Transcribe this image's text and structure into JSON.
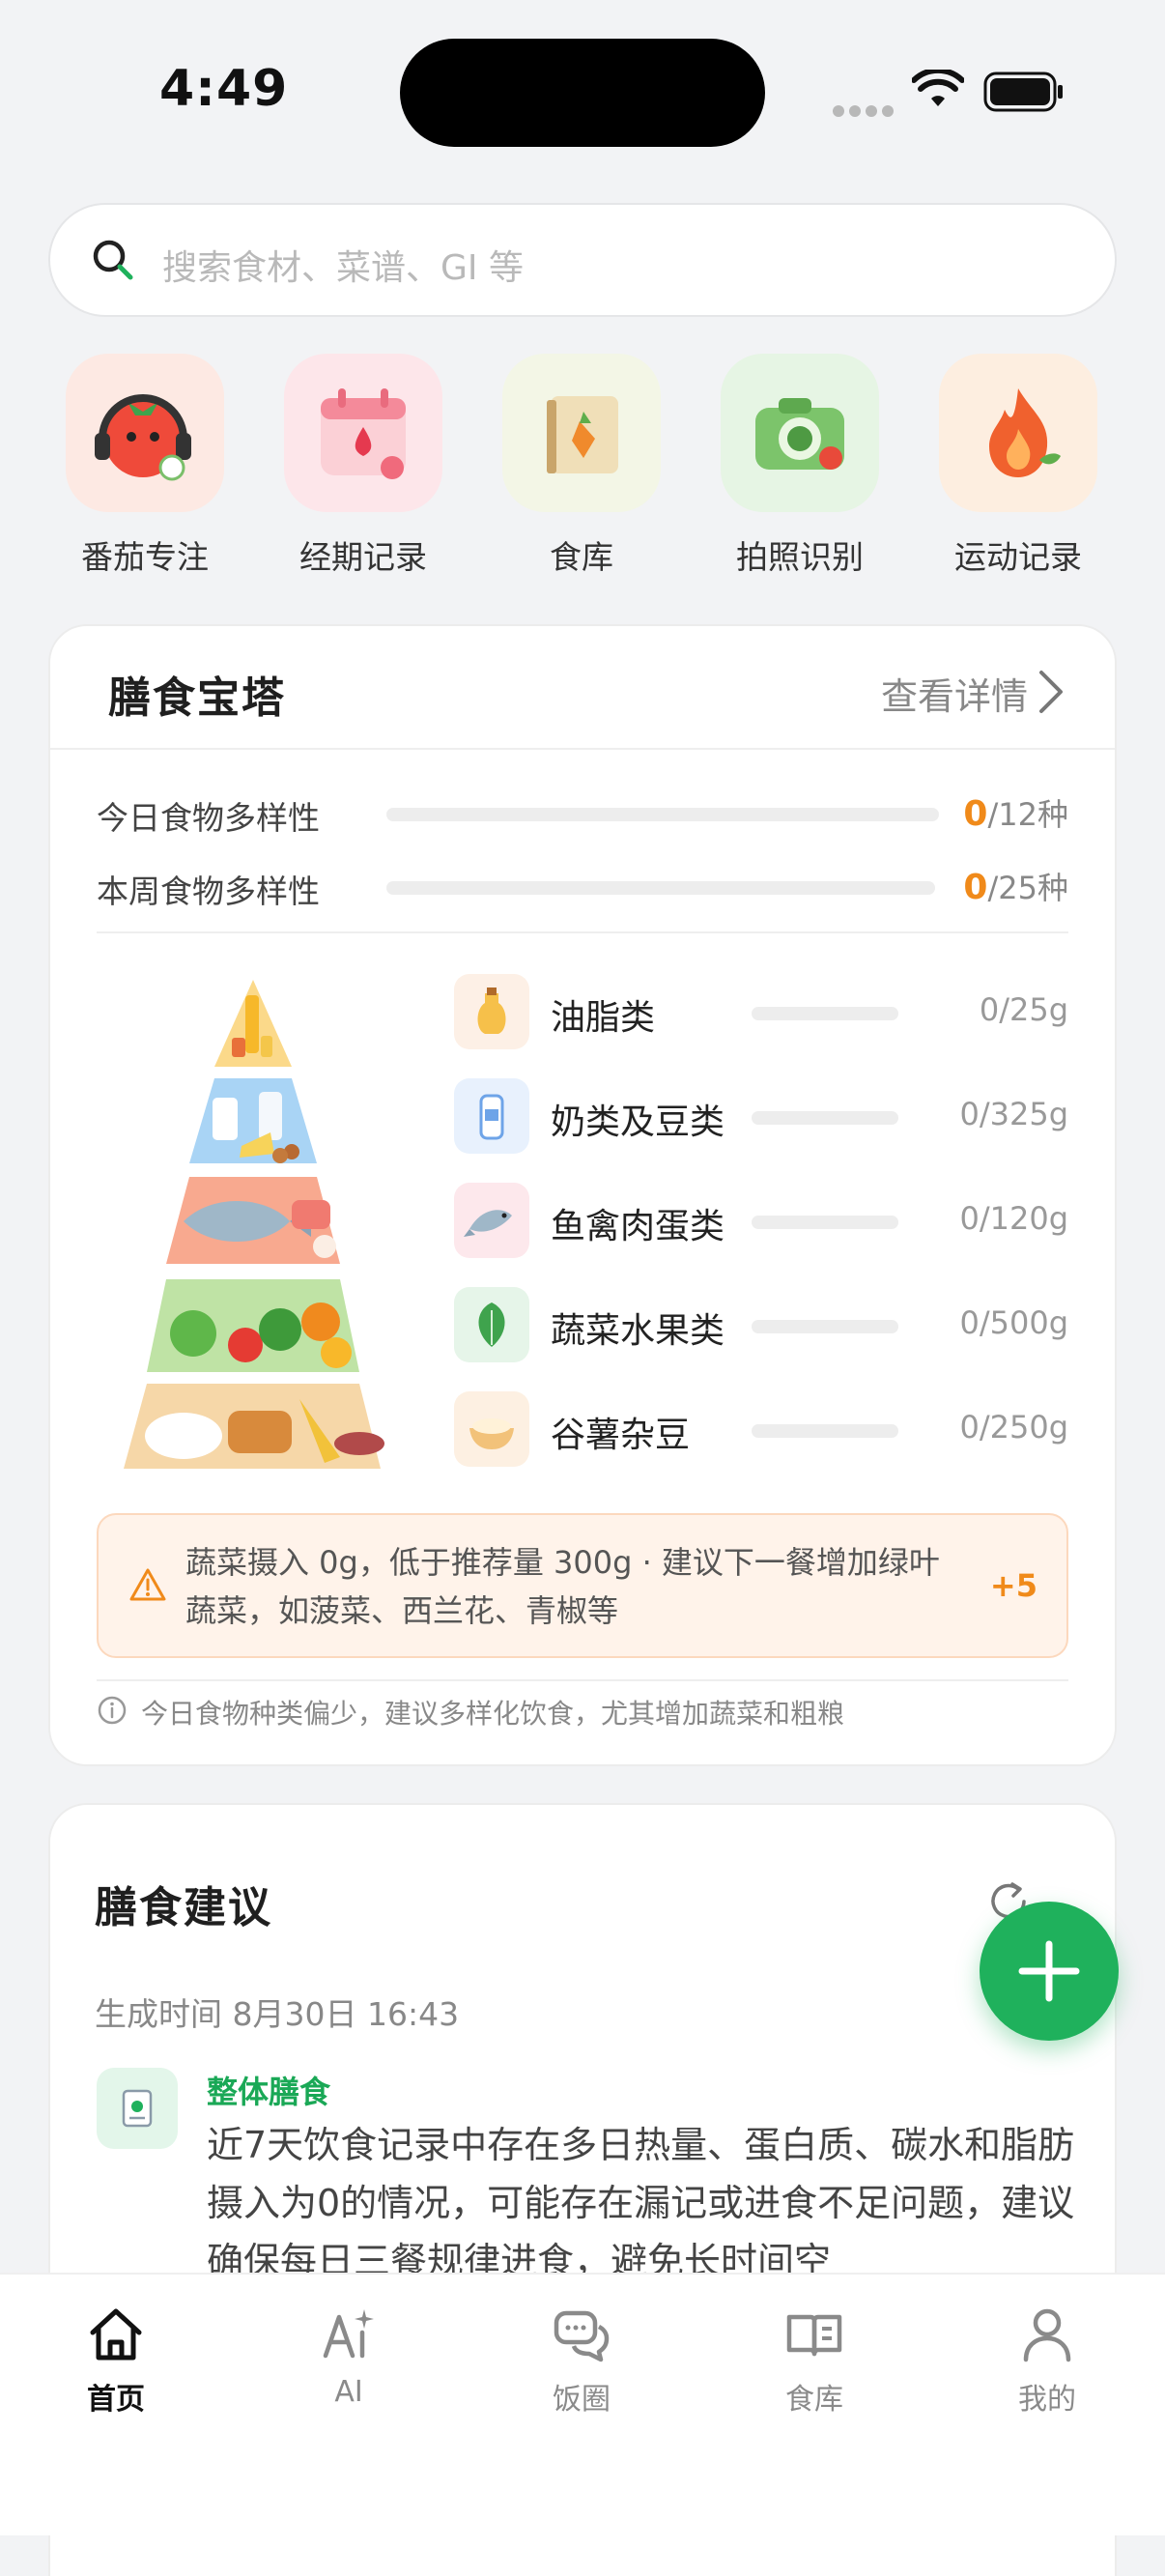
{
  "status_bar": {
    "time": "4:49"
  },
  "search": {
    "placeholder": "搜索食材、菜谱、GI 等"
  },
  "quick_tiles": [
    {
      "label": "番茄专注",
      "icon": "tomato-headphones-icon",
      "bg": "#fde9e3"
    },
    {
      "label": "经期记录",
      "icon": "period-calendar-icon",
      "bg": "#fde6ea"
    },
    {
      "label": "食库",
      "icon": "food-book-icon",
      "bg": "#f3f6e6"
    },
    {
      "label": "拍照识别",
      "icon": "camera-icon",
      "bg": "#e6f5e4"
    },
    {
      "label": "运动记录",
      "icon": "flame-icon",
      "bg": "#fdeee0"
    }
  ],
  "pyramid_card": {
    "title": "膳食宝塔",
    "more": "查看详情",
    "diversity": [
      {
        "label": "今日食物多样性",
        "count": "0",
        "total": "/12种",
        "progress": 0
      },
      {
        "label": "本周食物多样性",
        "count": "0",
        "total": "/25种",
        "progress": 0
      }
    ],
    "foods": [
      {
        "name": "油脂类",
        "value": "0/25g",
        "icon": "oil-icon",
        "bg": "#fdf0e6",
        "progress": 0
      },
      {
        "name": "奶类及豆类",
        "value": "0/325g",
        "icon": "milk-icon",
        "bg": "#e8f1fd",
        "progress": 0
      },
      {
        "name": "鱼禽肉蛋类",
        "value": "0/120g",
        "icon": "fish-icon",
        "bg": "#fde8ec",
        "progress": 0
      },
      {
        "name": "蔬菜水果类",
        "value": "0/500g",
        "icon": "leaf-icon",
        "bg": "#e6f5e9",
        "progress": 0
      },
      {
        "name": "谷薯杂豆",
        "value": "0/250g",
        "icon": "grain-bowl-icon",
        "bg": "#fdf0e2",
        "progress": 0
      }
    ],
    "tip": {
      "line1": "蔬菜摄入 0g，低于推荐量 300g · 建议下一餐增加绿叶",
      "line2": "蔬菜，如菠菜、西兰花、青椒等",
      "badge": "+5"
    },
    "note": "今日食物种类偏少，建议多样化饮食，尤其增加蔬菜和粗粮"
  },
  "advice_card": {
    "title": "膳食建议",
    "time": "生成时间 8月30日 16:43",
    "tag": "整体膳食",
    "text": "近7天饮食记录中存在多日热量、蛋白质、碳水和脂肪摄入为0的情况，可能存在漏记或进食不足问题，建议确保每日三餐规律进食，避免长时间空"
  },
  "tabs": [
    {
      "label": "首页",
      "icon": "home-icon",
      "active": true
    },
    {
      "label": "AI",
      "icon": "ai-icon",
      "active": false
    },
    {
      "label": "饭圈",
      "icon": "chat-icon",
      "active": false
    },
    {
      "label": "食库",
      "icon": "book-icon",
      "active": false
    },
    {
      "label": "我的",
      "icon": "profile-icon",
      "active": false
    }
  ],
  "colors": {
    "accent": "#1fb15c",
    "warn": "#f08a1a"
  }
}
